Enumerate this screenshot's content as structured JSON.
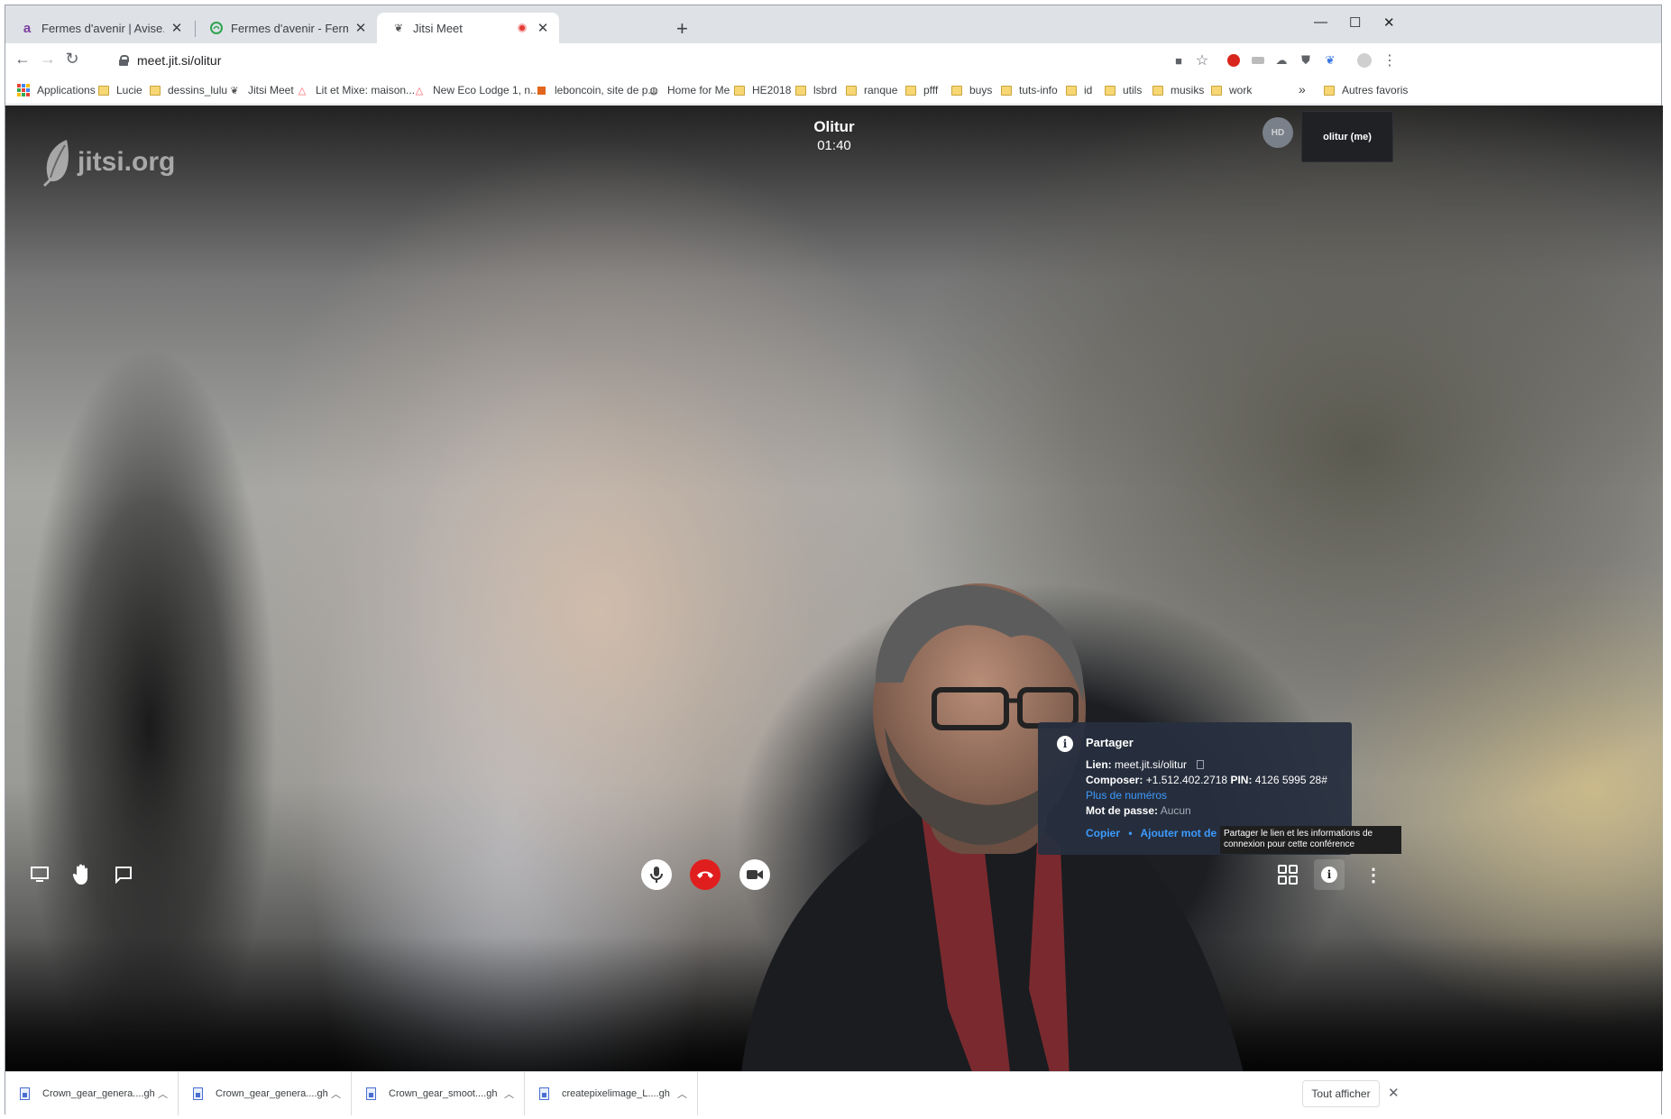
{
  "tabs": [
    {
      "title": "Fermes d'avenir | Avise.org",
      "favicon": "avise-icon",
      "color": "#7b3fa0"
    },
    {
      "title": "Fermes d'avenir - Fermes d'aven",
      "favicon": "fermes-icon",
      "color": "#2ea44f"
    },
    {
      "title": "Jitsi Meet",
      "favicon": "jitsi-icon",
      "recording": true
    }
  ],
  "address": {
    "url": "meet.jit.si/olitur"
  },
  "bookmarks": [
    {
      "label": "Applications",
      "icon": "apps-grid-icon"
    },
    {
      "label": "Lucie",
      "icon": "folder-icon"
    },
    {
      "label": "dessins_lulu",
      "icon": "folder-icon"
    },
    {
      "label": "Jitsi Meet",
      "icon": "jitsi-icon"
    },
    {
      "label": "Lit et Mixe: maison...",
      "icon": "airbnb-icon"
    },
    {
      "label": "New Eco Lodge 1, n...",
      "icon": "airbnb-icon"
    },
    {
      "label": "leboncoin, site de p...",
      "icon": "leboncoin-icon"
    },
    {
      "label": "Home for Me",
      "icon": "globe-icon"
    },
    {
      "label": "HE2018",
      "icon": "folder-icon"
    },
    {
      "label": "lsbrd",
      "icon": "folder-icon"
    },
    {
      "label": "ranque",
      "icon": "folder-icon"
    },
    {
      "label": "pfff",
      "icon": "folder-icon"
    },
    {
      "label": "buys",
      "icon": "folder-icon"
    },
    {
      "label": "tuts-info",
      "icon": "folder-icon"
    },
    {
      "label": "id",
      "icon": "folder-icon"
    },
    {
      "label": "utils",
      "icon": "folder-icon"
    },
    {
      "label": "musiks",
      "icon": "folder-icon"
    },
    {
      "label": "work",
      "icon": "folder-icon"
    }
  ],
  "bookmarks_more": "»",
  "other_bookmarks": "Autres favoris",
  "meeting": {
    "logo": "jitsi.org",
    "name": "Olitur",
    "timer": "01:40",
    "quality_badge": "HD",
    "self_label": "olitur (me)"
  },
  "info_popup": {
    "title": "Partager",
    "link_label": "Lien:",
    "link_value": "meet.jit.si/olitur",
    "dial_label": "Composer:",
    "dial_number": "+1.512.402.2718",
    "pin_label": "PIN:",
    "pin_value": "4126 5995 28#",
    "more_numbers": "Plus de numéros",
    "password_label": "Mot de passe:",
    "password_value": "Aucun",
    "copy_action": "Copier",
    "separator": "•",
    "add_password_action": "Ajouter mot de"
  },
  "tooltip": "Partager le lien et les informations de connexion pour cette conférence",
  "downloads": [
    {
      "name": "Crown_gear_genera....gh"
    },
    {
      "name": "Crown_gear_genera....gh"
    },
    {
      "name": "Crown_gear_smoot....gh"
    },
    {
      "name": "createpixelimage_L....gh"
    }
  ],
  "downloads_show_all": "Tout afficher",
  "colors": {
    "hangup": "#e11e1e",
    "link": "#3d9bff",
    "popup_bg": "#272f3f"
  }
}
